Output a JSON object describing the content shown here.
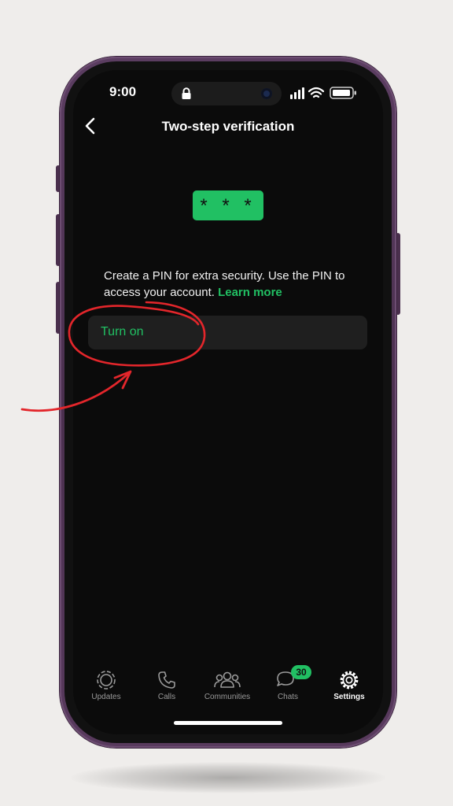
{
  "status_bar": {
    "time": "9:00"
  },
  "header": {
    "back_icon": "chevron-left-icon",
    "title": "Two-step verification"
  },
  "pin_badge": {
    "text": "* * *"
  },
  "description": {
    "text": "Create a PIN for extra security. Use the PIN to access your account.",
    "link": "Learn more"
  },
  "action": {
    "label": "Turn on"
  },
  "tabs": [
    {
      "label": "Updates",
      "icon": "updates-icon"
    },
    {
      "label": "Calls",
      "icon": "phone-icon"
    },
    {
      "label": "Communities",
      "icon": "communities-icon"
    },
    {
      "label": "Chats",
      "icon": "chats-icon",
      "badge": "30"
    },
    {
      "label": "Settings",
      "icon": "gear-icon",
      "active": true
    }
  ],
  "colors": {
    "accent": "#21c063",
    "annotation": "#e3262b",
    "phone_frame": "#4b304f",
    "screen_bg": "#0b0b0b"
  }
}
